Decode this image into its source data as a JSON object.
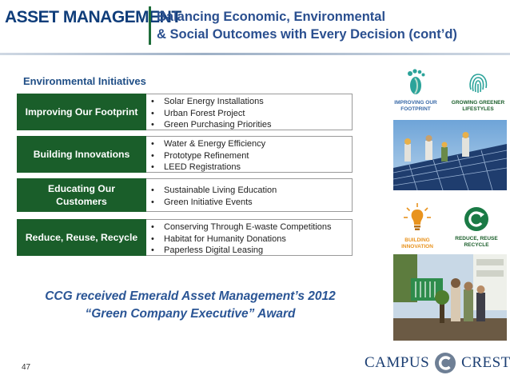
{
  "header": {
    "logo": "ASSET MANAGEMENT",
    "title_line1": "Balancing Economic, Environmental",
    "title_line2": "& Social Outcomes with Every Decision (cont’d)"
  },
  "section": {
    "title": "Environmental Initiatives"
  },
  "rows": [
    {
      "label": "Improving Our Footprint",
      "items": [
        "Solar Energy Installations",
        "Urban Forest Project",
        "Green Purchasing Priorities"
      ]
    },
    {
      "label": "Building Innovations",
      "items": [
        "Water & Energy Efficiency",
        "Prototype Refinement",
        "LEED Registrations"
      ]
    },
    {
      "label_line1": "Educating Our",
      "label_line2": "Customers",
      "items": [
        "Sustainable Living Education",
        "Green Initiative Events"
      ]
    },
    {
      "label": "Reduce, Reuse, Recycle",
      "items": [
        "Conserving Through E-waste Competitions",
        "Habitat for Humanity Donations",
        "Paperless Digital Leasing"
      ]
    }
  ],
  "bullet": "•",
  "award": {
    "line1": "CCG received Emerald Asset Management’s 2012",
    "line2": "“Green Company Executive” Award"
  },
  "icons": [
    {
      "name": "footprint-icon",
      "label_line1": "IMPROVING OUR",
      "label_line2": "FOOTPRINT"
    },
    {
      "name": "fingerprint-icon",
      "label_line1": "GROWING GREENER",
      "label_line2": "LIFESTYLES"
    },
    {
      "name": "lightbulb-icon",
      "label_line1": "BUILDING",
      "label_line2": "INNOVATION"
    },
    {
      "name": "recycle-icon",
      "label_line1": "REDUCE, REUSE",
      "label_line2": "RECYCLE"
    }
  ],
  "footer": {
    "page_number": "47",
    "brand_left": "CAMPUS",
    "brand_right": "CREST"
  },
  "colors": {
    "label_green": "#1a5e2a",
    "title_blue": "#2a4f8f",
    "award_blue": "#2a5595",
    "icon_teal": "#2ba39a",
    "icon_orange": "#e8931e"
  }
}
